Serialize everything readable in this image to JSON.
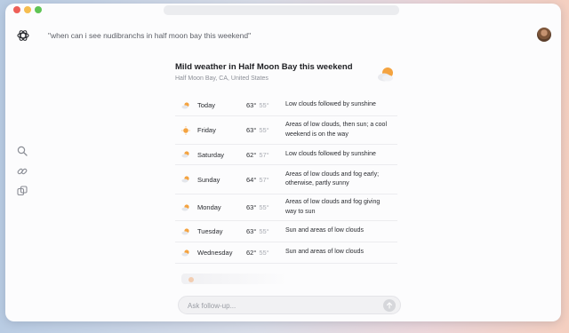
{
  "query": "\"when can i see nudibranchs in half moon bay this weekend\"",
  "result": {
    "title": "Mild weather in Half Moon Bay this weekend",
    "location": "Half Moon Bay, CA, United States"
  },
  "forecast": [
    {
      "day": "Today",
      "hi": "63°",
      "lo": "55°",
      "desc": "Low clouds followed by sunshine",
      "icon": "partly-sunny-icon"
    },
    {
      "day": "Friday",
      "hi": "63°",
      "lo": "55°",
      "desc": "Areas of low clouds, then sun; a cool weekend is on the way",
      "icon": "sunny-icon"
    },
    {
      "day": "Saturday",
      "hi": "62°",
      "lo": "57°",
      "desc": "Low clouds followed by sunshine",
      "icon": "partly-sunny-icon"
    },
    {
      "day": "Sunday",
      "hi": "64°",
      "lo": "57°",
      "desc": "Areas of low clouds and fog early; otherwise, partly sunny",
      "icon": "partly-sunny-icon"
    },
    {
      "day": "Monday",
      "hi": "63°",
      "lo": "55°",
      "desc": "Areas of low clouds and fog giving way to sun",
      "icon": "partly-sunny-icon"
    },
    {
      "day": "Tuesday",
      "hi": "63°",
      "lo": "55°",
      "desc": "Sun and areas of low clouds",
      "icon": "partly-sunny-icon"
    },
    {
      "day": "Wednesday",
      "hi": "62°",
      "lo": "55°",
      "desc": "Sun and areas of low clouds",
      "icon": "partly-sunny-icon"
    }
  ],
  "followup": {
    "placeholder": "Ask follow-up..."
  },
  "colors": {
    "sun": "#f4a340",
    "cloud": "#e4e6eb",
    "accent": "#1d1e22"
  }
}
